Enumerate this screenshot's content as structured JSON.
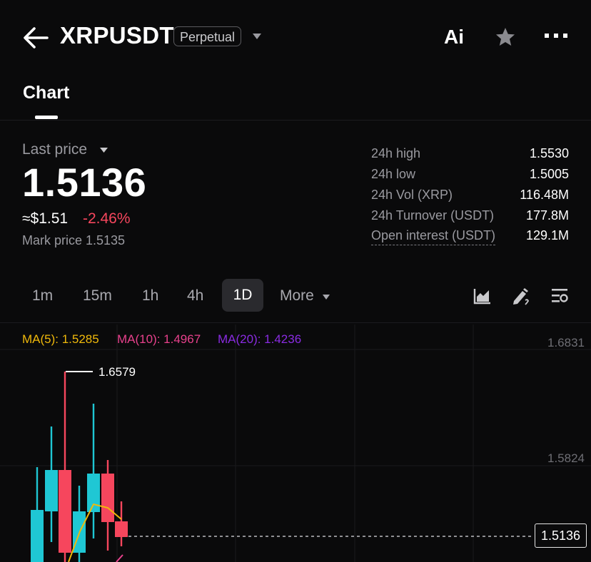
{
  "header": {
    "symbol": "XRPUSDT",
    "contract_type": "Perpetual",
    "ai_label": "Ai",
    "icons": [
      "back-arrow-icon",
      "chevron-down-icon",
      "star-icon",
      "more-dots-icon"
    ]
  },
  "tabs": [
    {
      "label": "Chart",
      "active": true
    }
  ],
  "price_panel": {
    "last_label": "Last price",
    "last_price": "1.5136",
    "approx": "≈$1.51",
    "change": "-2.46%",
    "mark_price": "Mark price 1.5135",
    "stats": [
      {
        "label": "24h high",
        "value": "1.5530"
      },
      {
        "label": "24h low",
        "value": "1.5005"
      },
      {
        "label": "24h Vol (XRP)",
        "value": "116.48M"
      },
      {
        "label": "24h Turnover (USDT)",
        "value": "177.8M"
      },
      {
        "label": "Open interest (USDT)",
        "value": "129.1M"
      }
    ]
  },
  "intervals": [
    "1m",
    "15m",
    "1h",
    "4h",
    "1D"
  ],
  "selected_interval": "1D",
  "more_label": "More",
  "toolbar_icons": [
    "chart-type-icon",
    "drawing-tool-icon",
    "indicator-settings-icon"
  ],
  "indicators": {
    "ma5": "MA(5): 1.5285",
    "ma10": "MA(10): 1.4967",
    "ma20": "MA(20): 1.4236"
  },
  "chart": {
    "y_labels": [
      "1.6831",
      "1.5824"
    ],
    "high_marker": "1.6579",
    "current_price_tag": "1.5136"
  },
  "colors": {
    "up": "#1fc7d4",
    "down": "#f6465d",
    "ma5": "#f0b90b",
    "ma10": "#e8418c",
    "ma20": "#8a2be2",
    "negative_change": "#f6465d"
  }
}
